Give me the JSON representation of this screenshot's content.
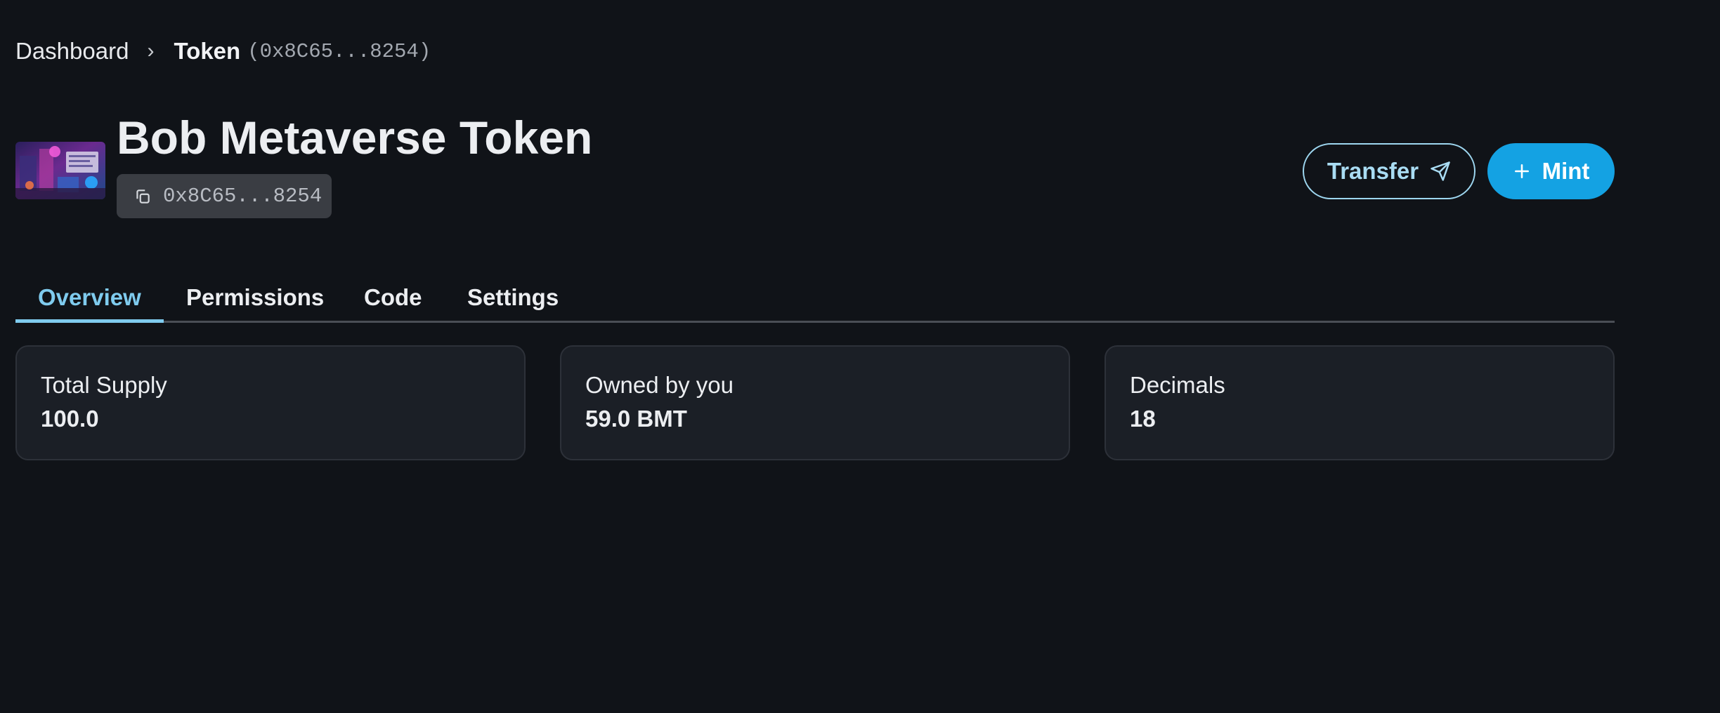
{
  "breadcrumb": {
    "root": "Dashboard",
    "separator": "›",
    "current": "Token",
    "address": "(0x8C65...8254)"
  },
  "token": {
    "name": "Bob Metaverse Token",
    "address_short": "0x8C65...8254",
    "image_icon": "token-artwork-image"
  },
  "actions": {
    "transfer_label": "Transfer",
    "transfer_icon": "send-icon",
    "mint_label": "Mint",
    "mint_icon": "plus-icon"
  },
  "tabs": [
    {
      "label": "Overview",
      "active": true
    },
    {
      "label": "Permissions",
      "active": false
    },
    {
      "label": "Code",
      "active": false
    },
    {
      "label": "Settings",
      "active": false
    }
  ],
  "stats": [
    {
      "label": "Total Supply",
      "value": "100.0"
    },
    {
      "label": "Owned by you",
      "value": "59.0 BMT"
    },
    {
      "label": "Decimals",
      "value": "18"
    }
  ],
  "colors": {
    "background": "#101318",
    "accent": "#14a2e3",
    "tab_active": "#7fcbee",
    "card_background": "#1b1f26"
  }
}
